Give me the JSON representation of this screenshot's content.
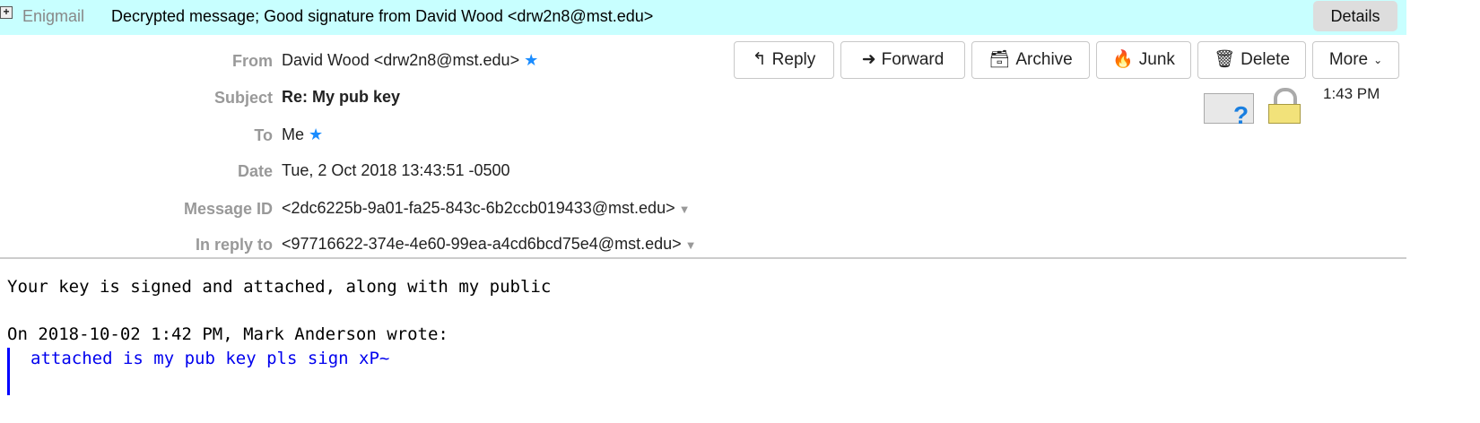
{
  "banner": {
    "label": "Enigmail",
    "message": "Decrypted message; Good signature from David Wood <drw2n8@mst.edu>",
    "details": "Details"
  },
  "toolbar": {
    "reply": "Reply",
    "forward": "Forward",
    "archive": "Archive",
    "junk": "Junk",
    "delete": "Delete",
    "more": "More"
  },
  "headers": {
    "from_label": "From",
    "from": "David Wood <drw2n8@mst.edu>",
    "subject_label": "Subject",
    "subject": "Re: My pub key",
    "to_label": "To",
    "to": "Me",
    "date_label": "Date",
    "date": "Tue, 2 Oct 2018 13:43:51 -0500",
    "msgid_label": "Message ID",
    "msgid": "<2dc6225b-9a01-fa25-843c-6b2ccb019433@mst.edu>",
    "reply_label": "In reply to",
    "reply": "<97716622-374e-4e60-99ea-a4cd6bcd75e4@mst.edu>",
    "time": "1:43 PM"
  },
  "body": {
    "line1": "Your key is signed and attached, along with my public",
    "attribution": "On 2018-10-02 1:42 PM, Mark Anderson wrote:",
    "quote": "attached is my pub key pls sign xP~"
  }
}
